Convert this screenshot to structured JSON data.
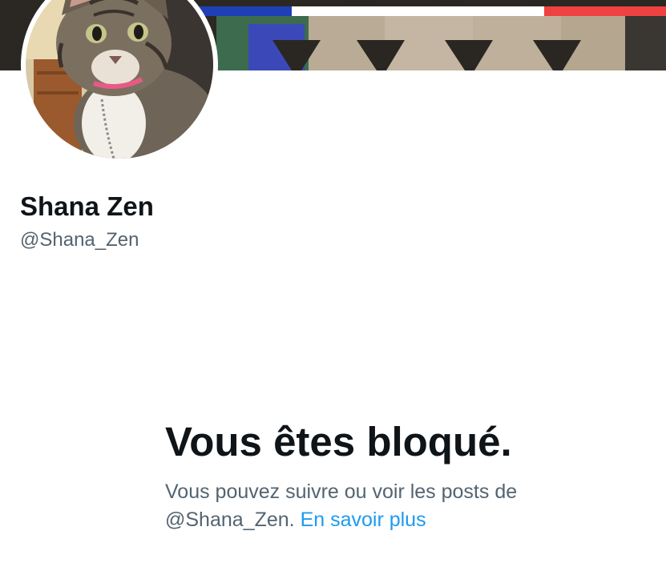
{
  "profile": {
    "display_name": "Shana Zen",
    "handle": "@Shana_Zen"
  },
  "blocked": {
    "title": "Vous êtes bloqué.",
    "message_part1": "Vous pouvez suivre ou voir les posts de",
    "message_handle": "@Shana_Zen.",
    "learn_more": "En savoir plus"
  },
  "colors": {
    "text_primary": "#0f1419",
    "text_secondary": "#536471",
    "link": "#1d9bf0",
    "banner_flag_blue": "#1f3fb7",
    "banner_flag_white": "#ffffff",
    "banner_flag_red": "#ef4140"
  },
  "icons": {
    "avatar": "cat-photo",
    "banner": "decorated-wall-photo"
  }
}
